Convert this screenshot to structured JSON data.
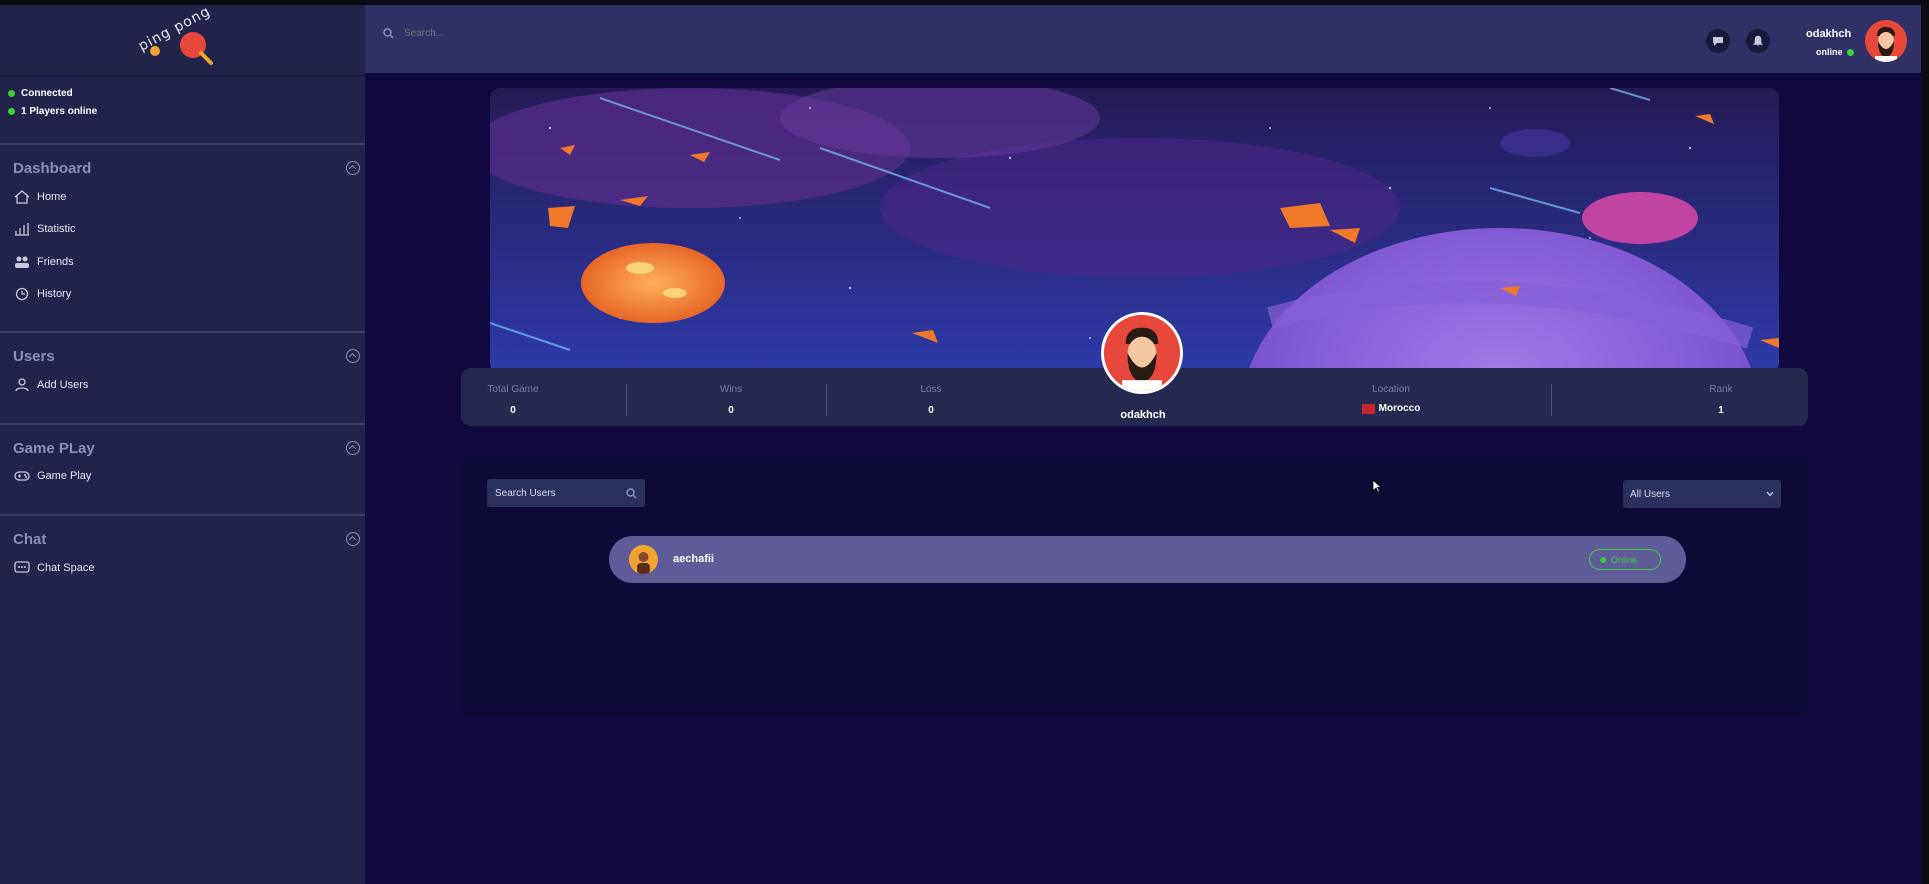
{
  "brand": {
    "logo_text": "ping pong"
  },
  "connection": {
    "connected_label": "Connected",
    "players_online_label": "1  Players online"
  },
  "sidebar": {
    "sections": [
      {
        "title": "Dashboard",
        "items": [
          {
            "label": "Home",
            "icon": "home-icon"
          },
          {
            "label": "Statistic",
            "icon": "chart-icon"
          },
          {
            "label": "Friends",
            "icon": "friends-icon"
          },
          {
            "label": "History",
            "icon": "history-icon"
          }
        ]
      },
      {
        "title": "Users",
        "items": [
          {
            "label": "Add Users",
            "icon": "add-user-icon"
          }
        ]
      },
      {
        "title": "Game PLay",
        "items": [
          {
            "label": "Game Play",
            "icon": "gamepad-icon"
          }
        ]
      },
      {
        "title": "Chat",
        "items": [
          {
            "label": "Chat Space",
            "icon": "chat-icon"
          }
        ]
      }
    ]
  },
  "topbar": {
    "search_placeholder": "Search...",
    "username": "odakhch",
    "status": "online"
  },
  "profile": {
    "username": "odakhch",
    "stats": {
      "total_game_label": "Total Game",
      "total_game": "0",
      "wins_label": "Wins",
      "wins": "0",
      "loss_label": "Loss",
      "loss": "0",
      "location_label": "Location",
      "location": "Morocco",
      "rank_label": "Rank",
      "rank": "1"
    }
  },
  "users_panel": {
    "search_placeholder": "Search Users",
    "filter_value": "All Users",
    "users": [
      {
        "name": "aechafii",
        "status": "Online"
      }
    ]
  },
  "colors": {
    "sidebar_bg": "#21234a",
    "topbar_bg": "#2f3166",
    "main_bg": "#10083f",
    "online_green": "#3ad13a",
    "accent_red": "#e8473b"
  }
}
